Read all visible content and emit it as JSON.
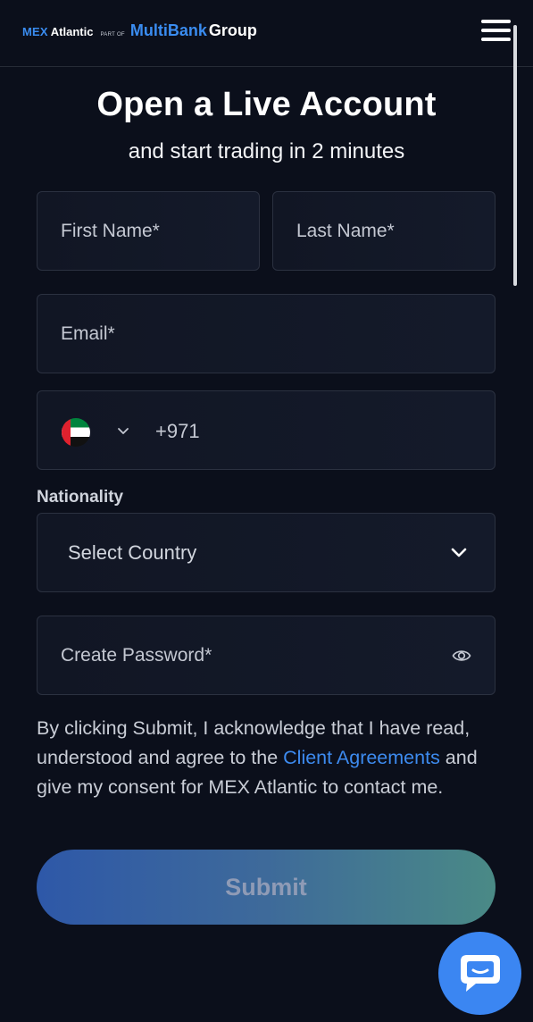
{
  "header": {
    "logo": {
      "mex": "MEX",
      "atlantic": "Atlantic",
      "part_of": "PART OF",
      "multi": "MultiBank",
      "group": "Group"
    },
    "menu_icon": "hamburger-icon"
  },
  "heading": {
    "title": "Open a Live Account",
    "subtitle": "and start trading in 2 minutes"
  },
  "form": {
    "first_name_placeholder": "First Name*",
    "last_name_placeholder": "Last Name*",
    "email_placeholder": "Email*",
    "phone": {
      "flag": "uae-flag-icon",
      "dial_code": "+971"
    },
    "nationality_label": "Nationality",
    "country_select": "Select Country",
    "password_placeholder": "Create Password*"
  },
  "consent": {
    "text_before": "By clicking Submit, I acknowledge that I have read, understood and agree to the ",
    "link": "Client Agreements",
    "text_after": " and give my consent for MEX Atlantic to contact me."
  },
  "submit_label": "Submit",
  "chat_icon": "chat-bubble-icon"
}
